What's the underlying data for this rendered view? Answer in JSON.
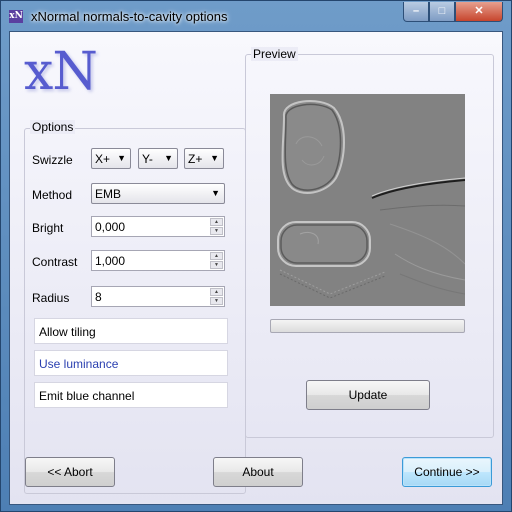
{
  "window": {
    "title": "xNormal normals-to-cavity options",
    "icon_text": "xN",
    "controls": {
      "minimize": "–",
      "maximize": "□",
      "close": "✕"
    }
  },
  "logo": "xN",
  "options": {
    "group_title": "Options",
    "swizzle_label": "Swizzle",
    "swizzle": [
      "X+",
      "Y-",
      "Z+"
    ],
    "method_label": "Method",
    "method_value": "EMB",
    "bright_label": "Bright",
    "bright_value": "0,000",
    "contrast_label": "Contrast",
    "contrast_value": "1,000",
    "radius_label": "Radius",
    "radius_value": "8",
    "allow_tiling": "Allow tiling",
    "use_luminance": "Use luminance",
    "emit_blue": "Emit blue channel"
  },
  "preview": {
    "group_title": "Preview",
    "progress": 0,
    "update_label": "Update"
  },
  "footer": {
    "abort_label": "<< Abort",
    "about_label": "About",
    "continue_label": "Continue >>"
  },
  "colors": {
    "titlebar": "#5b87b8",
    "client": "#ececf6",
    "preview_bg": "#818181",
    "logo": "#3c42c8",
    "luminance_text": "#2a3fb0",
    "default_button_border": "#3b9bd8"
  }
}
